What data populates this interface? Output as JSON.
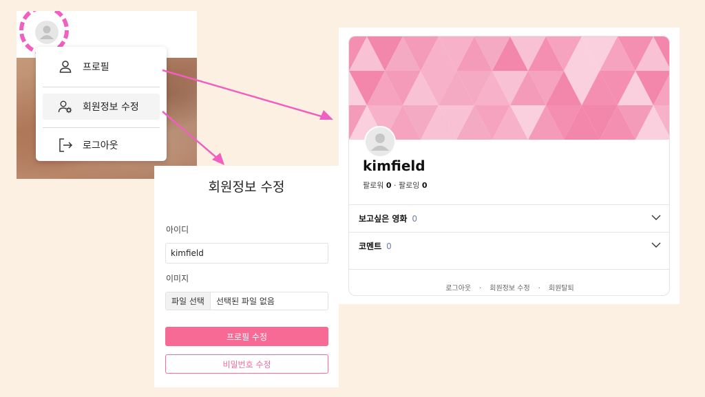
{
  "menu": {
    "items": [
      {
        "label": "프로필",
        "icon": "user-icon"
      },
      {
        "label": "회원정보 수정",
        "icon": "user-settings-icon"
      },
      {
        "label": "로그아웃",
        "icon": "logout-icon"
      }
    ]
  },
  "form": {
    "title": "회원정보 수정",
    "id_label": "아이디",
    "id_value": "kimfield",
    "image_label": "이미지",
    "file_button": "파일 선택",
    "file_status": "선택된 파일 없음",
    "save_button": "프로필 수정",
    "password_button": "비밀번호 수정"
  },
  "profile": {
    "username": "kimfield",
    "follower_label": "팔로워",
    "follower_count": "0",
    "following_label": "팔로잉",
    "following_count": "0",
    "sections": [
      {
        "title": "보고싶은 영화",
        "count": "0"
      },
      {
        "title": "코멘트",
        "count": "0"
      }
    ],
    "footer": [
      "로그아웃",
      "회원정보 수정",
      "회원탈퇴"
    ]
  },
  "colors": {
    "accent": "#f86a96",
    "highlight": "#f15fbf",
    "background": "#fcf0e3"
  }
}
